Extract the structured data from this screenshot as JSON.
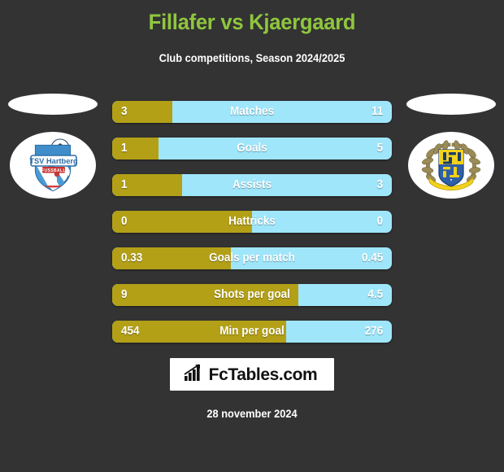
{
  "header": {
    "title": "Fillafer vs Kjaergaard",
    "subtitle": "Club competitions, Season 2024/2025"
  },
  "colors": {
    "background": "#333333",
    "title": "#8fc63d",
    "home_bar": "#b3a017",
    "away_bar": "#9fe6fb",
    "text": "#ffffff"
  },
  "teams": {
    "home": {
      "crest_name": "tsv-hartberg-crest",
      "crest_text": "TSV Hartberg",
      "crest_subtext": "FUSSBALL"
    },
    "away": {
      "crest_name": "laurel-wreath-crest",
      "crest_text": ""
    }
  },
  "stats": [
    {
      "label": "Matches",
      "home": "3",
      "away": "11",
      "home_pct": 21.4
    },
    {
      "label": "Goals",
      "home": "1",
      "away": "5",
      "home_pct": 16.7
    },
    {
      "label": "Assists",
      "home": "1",
      "away": "3",
      "home_pct": 25.0
    },
    {
      "label": "Hattricks",
      "home": "0",
      "away": "0",
      "home_pct": 50.0
    },
    {
      "label": "Goals per match",
      "home": "0.33",
      "away": "0.45",
      "home_pct": 42.3
    },
    {
      "label": "Shots per goal",
      "home": "9",
      "away": "4.5",
      "home_pct": 66.7
    },
    {
      "label": "Min per goal",
      "home": "454",
      "away": "276",
      "home_pct": 62.2
    }
  ],
  "footer": {
    "brand": "FcTables.com",
    "brand_icon": "bar-chart-icon",
    "date": "28 november 2024"
  }
}
